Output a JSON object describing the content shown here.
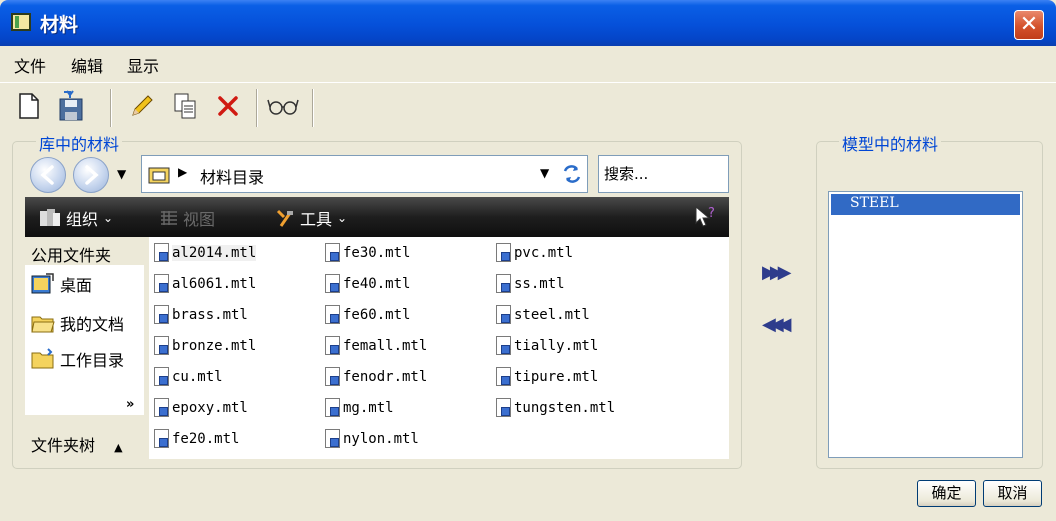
{
  "window": {
    "title": "材料",
    "close_glyph": "✕"
  },
  "menu": [
    "文件",
    "编辑",
    "显示"
  ],
  "toolbar": {
    "icons": [
      "new-file-icon",
      "save-icon",
      "edit-pencil-icon",
      "copy-icon",
      "delete-icon",
      "view-glasses-icon"
    ]
  },
  "library": {
    "label": "库中的材料",
    "path": "材料目录",
    "search_placeholder": "搜索...",
    "commands": {
      "organize": "组织",
      "view": "视图",
      "tools": "工具"
    },
    "sidebar": {
      "common_folders": "公用文件夹",
      "items": [
        "桌面",
        "我的文档",
        "工作目录"
      ],
      "folder_tree": "文件夹树"
    },
    "files": [
      "al2014.mtl",
      "al6061.mtl",
      "brass.mtl",
      "bronze.mtl",
      "cu.mtl",
      "epoxy.mtl",
      "fe20.mtl",
      "fe30.mtl",
      "fe40.mtl",
      "fe60.mtl",
      "femall.mtl",
      "fenodr.mtl",
      "mg.mtl",
      "nylon.mtl",
      "pvc.mtl",
      "ss.mtl",
      "steel.mtl",
      "tially.mtl",
      "tipure.mtl",
      "tungsten.mtl"
    ],
    "selected_file": "al2014.mtl"
  },
  "transfer": {
    "add_glyph": "▶▶▶",
    "remove_glyph": "◀◀◀"
  },
  "model": {
    "label": "模型中的材料",
    "items": [
      "STEEL"
    ]
  },
  "buttons": {
    "ok": "确定",
    "cancel": "取消"
  },
  "colors": {
    "title_bar": "#0550d9",
    "group_label": "#0046d5",
    "selection": "#316ac5",
    "command_bar": "#1e1e1e"
  }
}
